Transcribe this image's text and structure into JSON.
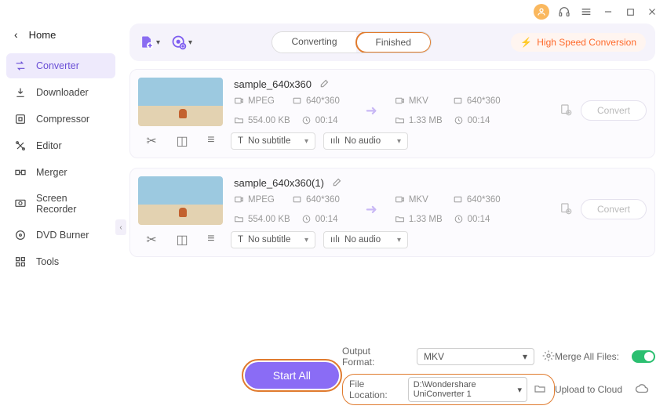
{
  "titlebar": {
    "avatar": "user-avatar"
  },
  "sidebar": {
    "home": "Home",
    "items": [
      {
        "label": "Converter",
        "active": true
      },
      {
        "label": "Downloader"
      },
      {
        "label": "Compressor"
      },
      {
        "label": "Editor"
      },
      {
        "label": "Merger"
      },
      {
        "label": "Screen Recorder"
      },
      {
        "label": "DVD Burner"
      },
      {
        "label": "Tools"
      }
    ]
  },
  "toolbar": {
    "tabs": {
      "converting": "Converting",
      "finished": "Finished"
    },
    "hsc": "High Speed Conversion"
  },
  "files": [
    {
      "name": "sample_640x360",
      "src": {
        "format": "MPEG",
        "res": "640*360",
        "size": "554.00 KB",
        "dur": "00:14"
      },
      "dst": {
        "format": "MKV",
        "res": "640*360",
        "size": "1.33 MB",
        "dur": "00:14"
      },
      "subtitle": "No subtitle",
      "audio": "No audio",
      "convert": "Convert"
    },
    {
      "name": "sample_640x360(1)",
      "src": {
        "format": "MPEG",
        "res": "640*360",
        "size": "554.00 KB",
        "dur": "00:14"
      },
      "dst": {
        "format": "MKV",
        "res": "640*360",
        "size": "1.33 MB",
        "dur": "00:14"
      },
      "subtitle": "No subtitle",
      "audio": "No audio",
      "convert": "Convert"
    }
  ],
  "footer": {
    "output_format_label": "Output Format:",
    "output_format_value": "MKV",
    "merge_label": "Merge All Files:",
    "file_location_label": "File Location:",
    "file_location_value": "D:\\Wondershare UniConverter 1",
    "upload_label": "Upload to Cloud",
    "start_all": "Start All"
  }
}
